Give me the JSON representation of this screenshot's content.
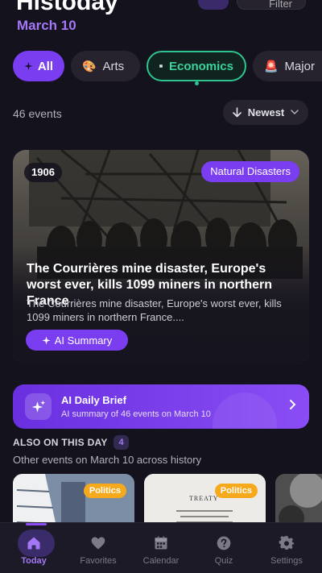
{
  "header": {
    "title": "Histoday",
    "date": "March 10",
    "filter_label": "Filter"
  },
  "chips": [
    {
      "label": "All",
      "icon": "sparkle-icon"
    },
    {
      "label": "Arts",
      "icon": "palette-icon"
    },
    {
      "label": "Economics",
      "icon": "chart-icon"
    },
    {
      "label": "Major",
      "icon": "alarm-icon"
    }
  ],
  "events": {
    "count_label": "46 events",
    "sort_label": "Newest"
  },
  "hero": {
    "year": "1906",
    "category": "Natural Disasters",
    "title": "The Courrières mine disaster, Europe's worst ever, kills 1099 miners in northern France",
    "description": "The Courrières mine disaster, Europe's worst ever, kills 1099 miners in northern France....",
    "ai_button": "AI Summary"
  },
  "brief": {
    "title": "AI Daily Brief",
    "subtitle": "AI summary of 46 events on March 10"
  },
  "also": {
    "title": "ALSO ON THIS DAY",
    "count": "4",
    "subtitle": "Other events on March 10 across history",
    "cards": [
      {
        "category": "Politics"
      },
      {
        "category": "Politics",
        "image_text": "TREATY"
      }
    ]
  },
  "tabs": [
    {
      "label": "Today",
      "icon": "home-icon",
      "active": true
    },
    {
      "label": "Favorites",
      "icon": "heart-icon"
    },
    {
      "label": "Calendar",
      "icon": "calendar-icon"
    },
    {
      "label": "Quiz",
      "icon": "question-icon"
    },
    {
      "label": "Settings",
      "icon": "gear-icon"
    }
  ],
  "colors": {
    "accent": "#7a3df0",
    "accent_light": "#a477f5",
    "economics": "#2fc38f",
    "politics": "#f7a91c",
    "background": "#14121d"
  }
}
